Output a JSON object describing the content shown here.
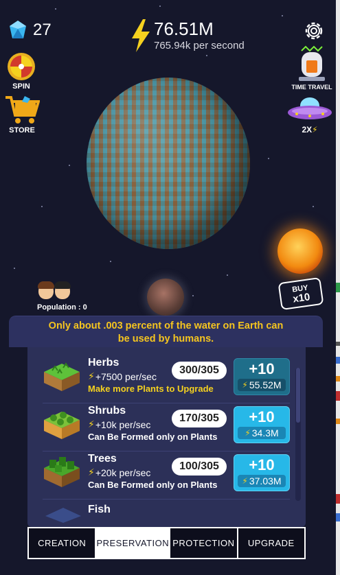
{
  "hud": {
    "gems": "27",
    "energy_total": "76.51M",
    "energy_rate": "765.94k per second"
  },
  "side": {
    "spin_label": "SPIN",
    "store_label": "STORE",
    "time_travel_label": "TIME TRAVEL",
    "boost_label": "2X"
  },
  "population": {
    "label": "Population : 0"
  },
  "buy": {
    "line1": "BUY",
    "line2": "x10"
  },
  "fact": {
    "line1": "Only about .003 percent of the water on Earth can",
    "line2": "be used by humans."
  },
  "items": [
    {
      "name": "Herbs",
      "rate": "+7500 per/sec",
      "count": "300/305",
      "plus": "+10",
      "cost": "55.52M",
      "note": "Make more Plants to Upgrade"
    },
    {
      "name": "Shrubs",
      "rate": "+10k per/sec",
      "count": "170/305",
      "plus": "+10",
      "cost": "34.3M",
      "note": "Can Be Formed only on Plants"
    },
    {
      "name": "Trees",
      "rate": "+20k per/sec",
      "count": "100/305",
      "plus": "+10",
      "cost": "37.03M",
      "note": "Can Be Formed only on Plants"
    },
    {
      "name": "Fish"
    }
  ],
  "tabs": [
    {
      "label": "CREATION"
    },
    {
      "label": "PRESERVATION"
    },
    {
      "label": "PROTECTION"
    },
    {
      "label": "UPGRADE"
    }
  ],
  "colors": {
    "background": "#15172b",
    "accent_yellow": "#f5c51f",
    "button_blue": "#27b8e8"
  }
}
